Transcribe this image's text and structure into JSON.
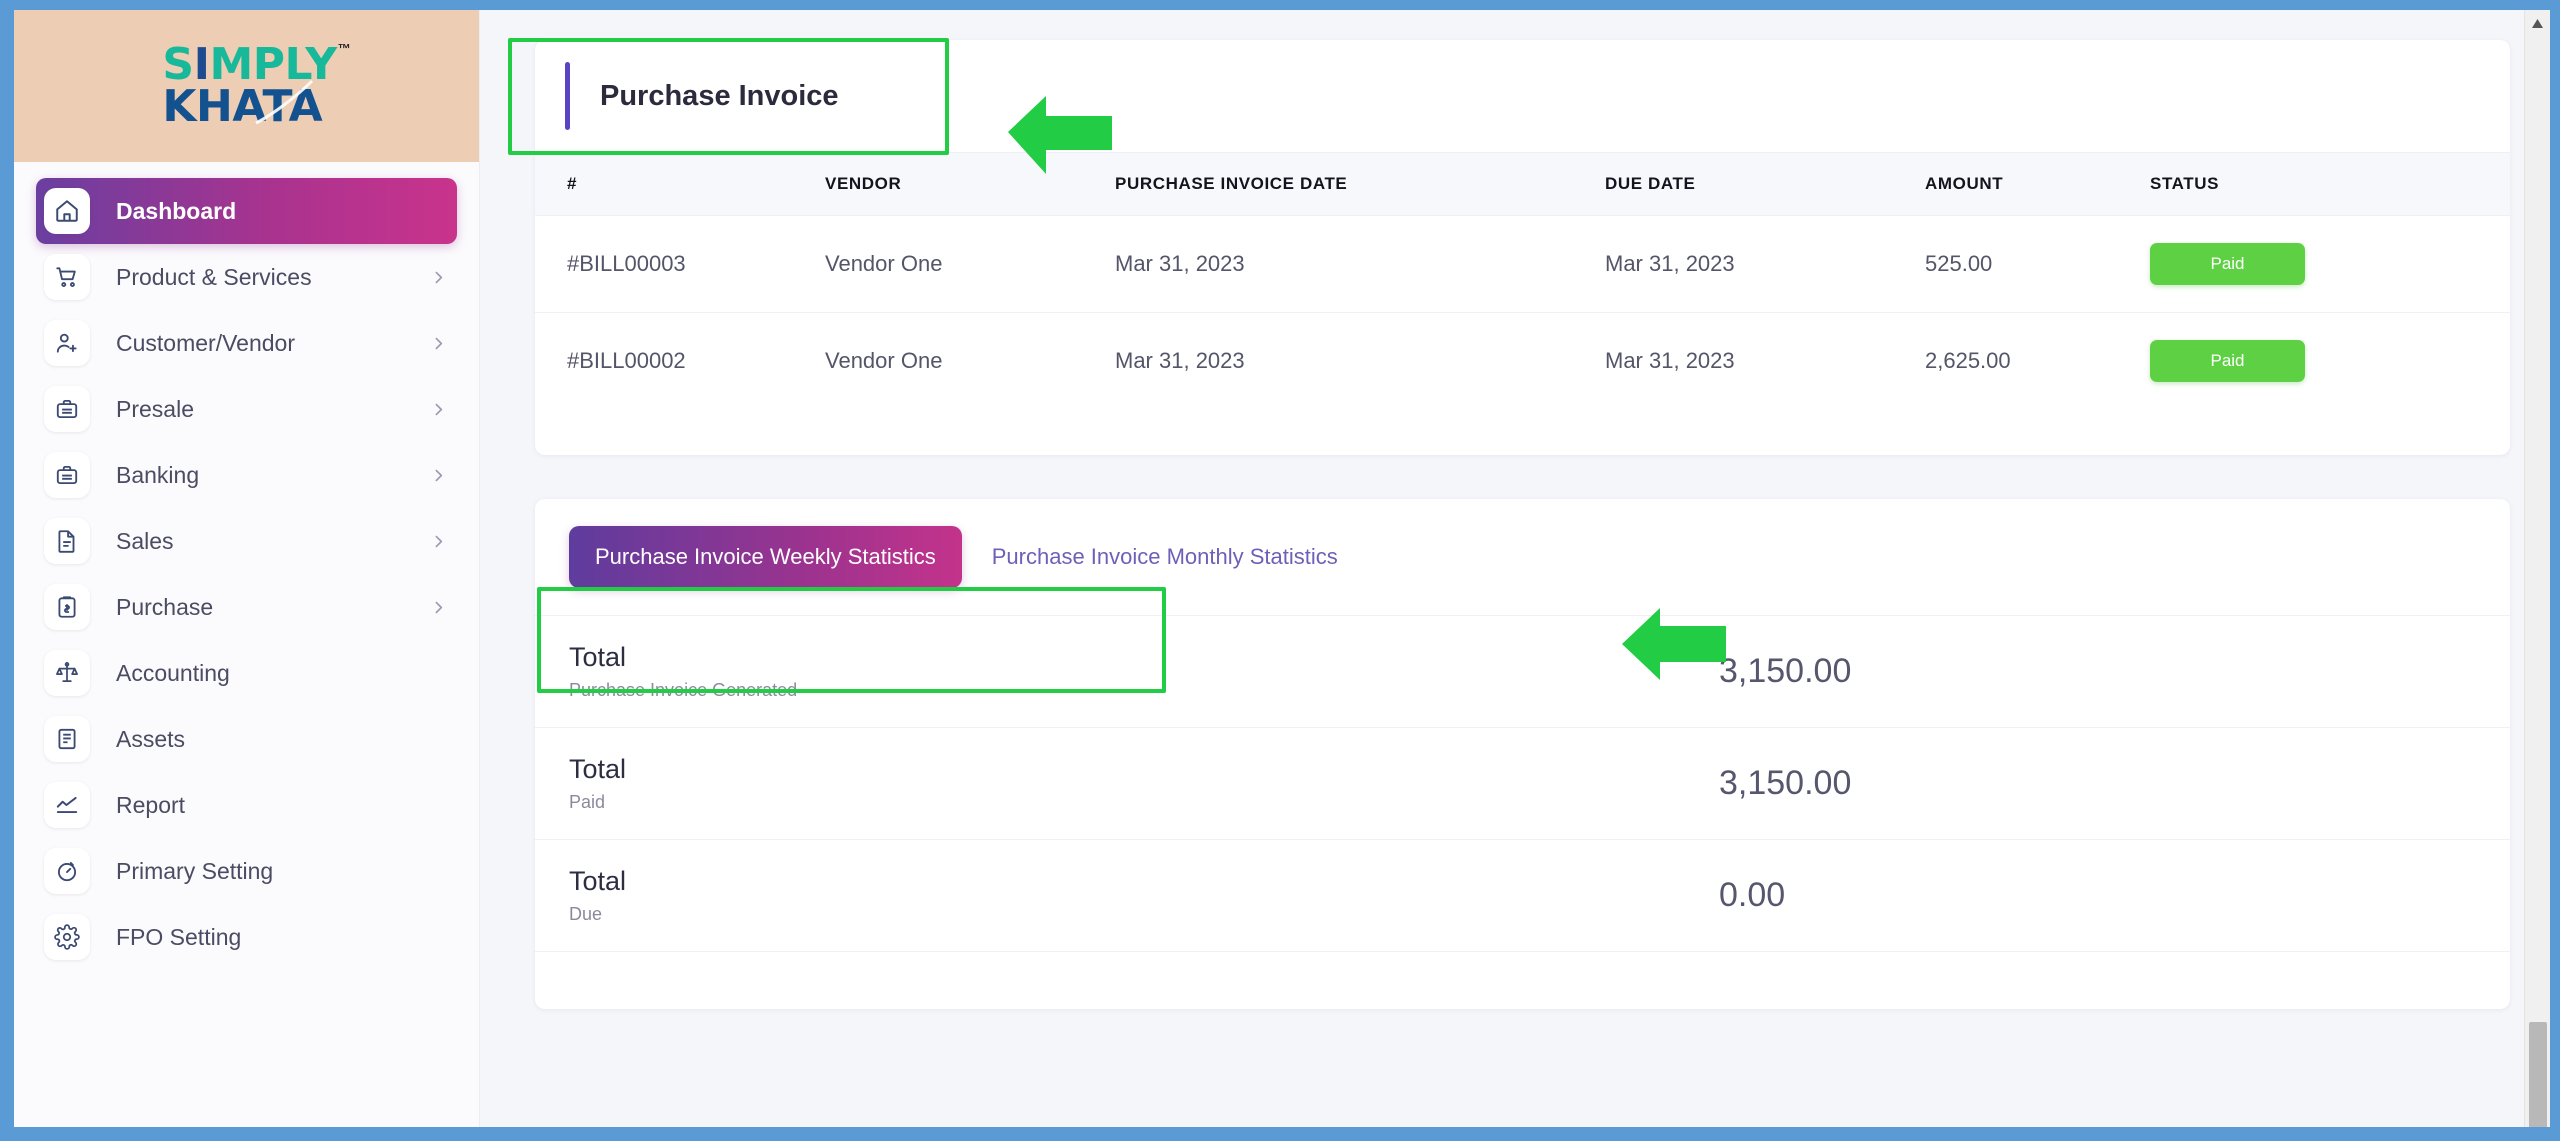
{
  "brand": {
    "logo_top": "SIMPLY",
    "logo_bottom": "KHATA",
    "trademark": "™",
    "logo_top_color": "#18b89b",
    "logo_bottom_color": "#14528f",
    "logo_bg_color": "#edcdb4"
  },
  "sidebar": {
    "items": [
      {
        "label": "Dashboard",
        "icon": "home-icon",
        "active": true,
        "chevron": false
      },
      {
        "label": "Product & Services",
        "icon": "cart-icon",
        "active": false,
        "chevron": true
      },
      {
        "label": "Customer/Vendor",
        "icon": "user-add-icon",
        "active": false,
        "chevron": true
      },
      {
        "label": "Presale",
        "icon": "briefcase-icon",
        "active": false,
        "chevron": true
      },
      {
        "label": "Banking",
        "icon": "briefcase-icon",
        "active": false,
        "chevron": true
      },
      {
        "label": "Sales",
        "icon": "document-icon",
        "active": false,
        "chevron": true
      },
      {
        "label": "Purchase",
        "icon": "clipboard-icon",
        "active": false,
        "chevron": true
      },
      {
        "label": "Accounting",
        "icon": "scales-icon",
        "active": false,
        "chevron": false
      },
      {
        "label": "Assets",
        "icon": "note-icon",
        "active": false,
        "chevron": false
      },
      {
        "label": "Report",
        "icon": "chart-icon",
        "active": false,
        "chevron": false
      },
      {
        "label": "Primary Setting",
        "icon": "stopwatch-icon",
        "active": false,
        "chevron": false
      },
      {
        "label": "FPO Setting",
        "icon": "gear-icon",
        "active": false,
        "chevron": false
      }
    ]
  },
  "invoice_card": {
    "title": "Purchase Invoice",
    "columns": [
      "#",
      "VENDOR",
      "PURCHASE INVOICE DATE",
      "DUE DATE",
      "AMOUNT",
      "STATUS"
    ],
    "rows": [
      {
        "number": "#BILL00003",
        "vendor": "Vendor One",
        "purchase_invoice_date": "Mar 31, 2023",
        "due_date": "Mar 31, 2023",
        "amount": "525.00",
        "status": "Paid"
      },
      {
        "number": "#BILL00002",
        "vendor": "Vendor One",
        "purchase_invoice_date": "Mar 31, 2023",
        "due_date": "Mar 31, 2023",
        "amount": "2,625.00",
        "status": "Paid"
      }
    ],
    "status_color": "#5dd143"
  },
  "stats_card": {
    "tabs": [
      {
        "label": "Purchase Invoice Weekly Statistics",
        "active": true
      },
      {
        "label": "Purchase Invoice Monthly Statistics",
        "active": false
      }
    ],
    "totals": [
      {
        "title": "Total",
        "subtitle": "Purchase Invoice Generated",
        "value": "3,150.00"
      },
      {
        "title": "Total",
        "subtitle": "Paid",
        "value": "3,150.00"
      },
      {
        "title": "Total",
        "subtitle": "Due",
        "value": "0.00"
      }
    ]
  },
  "annotations": {
    "color": "#22cc44",
    "highlight_title_box": "Purchase Invoice",
    "highlight_tabs_box": "Purchase Invoice Weekly Statistics / Purchase Invoice Monthly Statistics",
    "arrow_1": "arrow-left-icon",
    "arrow_2": "arrow-left-icon"
  },
  "scrollbar": {
    "up_arrow": "▲"
  }
}
